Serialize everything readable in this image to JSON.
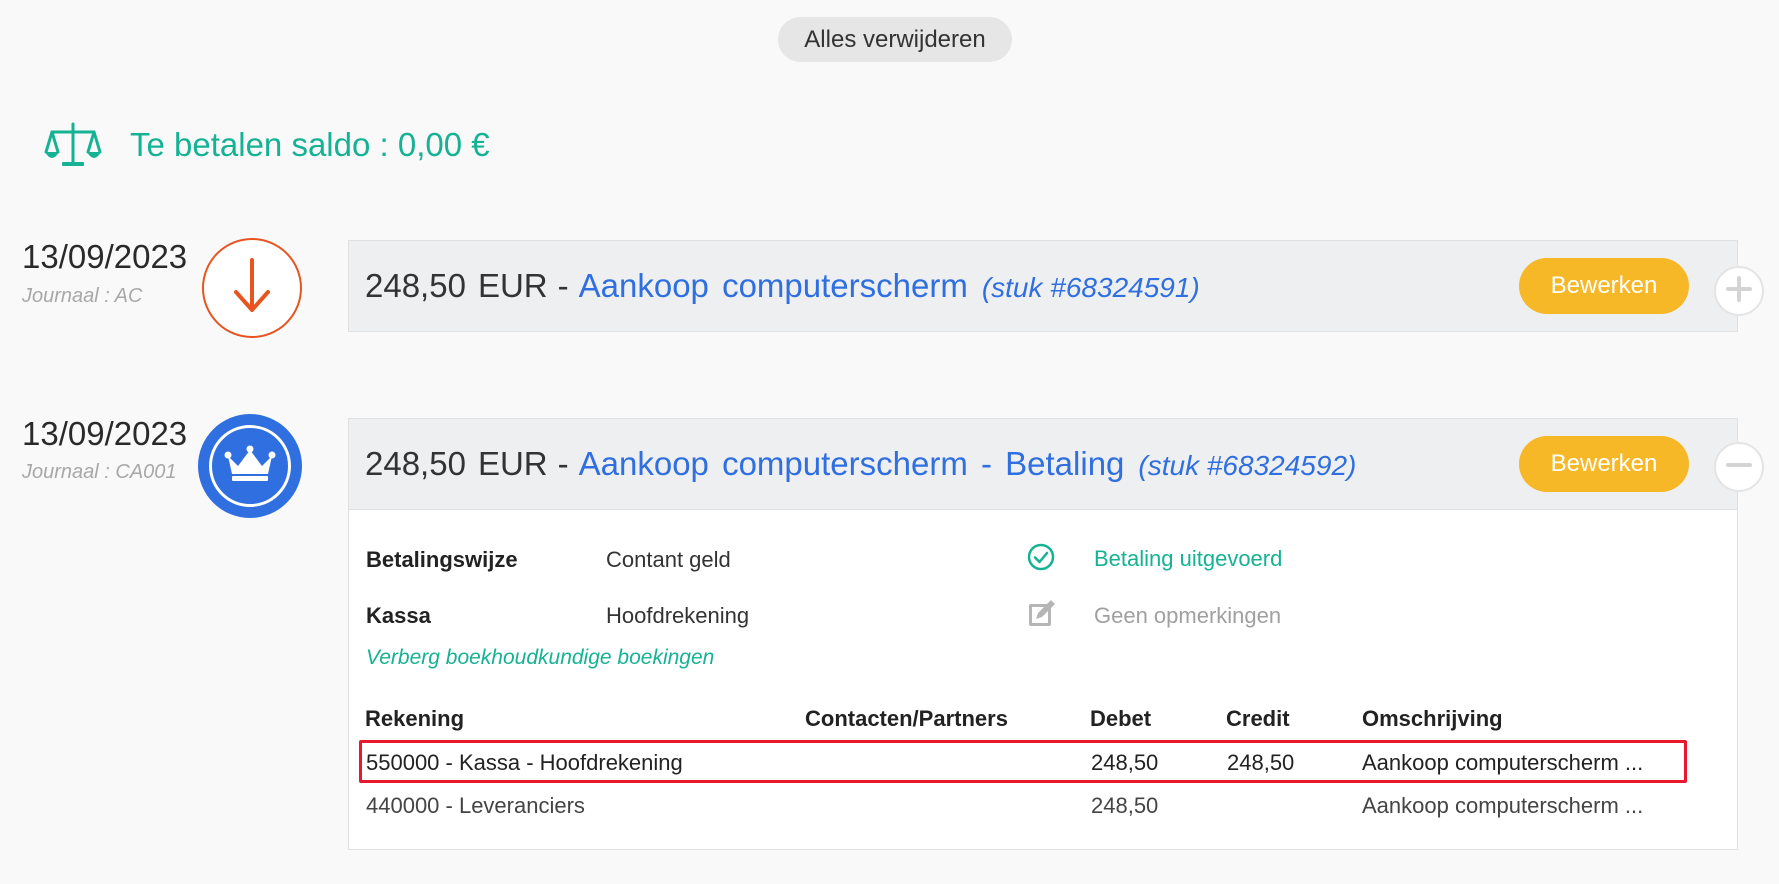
{
  "top": {
    "clear_all_label": "Alles verwijderen"
  },
  "balance": {
    "text": "Te betalen saldo : 0,00 €"
  },
  "entries": [
    {
      "date": "13/09/2023",
      "journal": "Journaal : AC",
      "icon": "arrow-down-icon",
      "amount": "248,50",
      "currency": "EUR",
      "separator": "-",
      "description": "Aankoop computerscherm",
      "piece": "(stuk #68324591)",
      "edit_label": "Bewerken",
      "toggle": "expand"
    },
    {
      "date": "13/09/2023",
      "journal": "Journaal : CA001",
      "icon": "crown-icon",
      "amount": "248,50",
      "currency": "EUR",
      "separator": "-",
      "description": "Aankoop computerscherm - Betaling",
      "piece": "(stuk #68324592)",
      "edit_label": "Bewerken",
      "toggle": "collapse",
      "details": {
        "payment_method_label": "Betalingswijze",
        "payment_method_value": "Contant geld",
        "register_label": "Kassa",
        "register_value": "Hoofdrekening",
        "payment_status": "Betaling uitgevoerd",
        "notes_status": "Geen opmerkingen",
        "toggle_link": "Verberg boekhoudkundige boekingen",
        "table": {
          "headers": [
            "Rekening",
            "Contacten/Partners",
            "Debet",
            "Credit",
            "Omschrijving"
          ],
          "rows": [
            {
              "account": "550000 - Kassa - Hoofdrekening",
              "contact": "",
              "debit": "248,50",
              "credit": "248,50",
              "description": "Aankoop computerscherm ...",
              "highlighted": true
            },
            {
              "account": "440000 - Leveranciers",
              "contact": "",
              "debit": "248,50",
              "credit": "",
              "description": "Aankoop computerscherm ...",
              "highlighted": false
            }
          ]
        }
      }
    }
  ],
  "colors": {
    "accent_green": "#16b294",
    "accent_blue": "#2f6fe0",
    "edit_yellow": "#f6b826",
    "out_orange": "#e8541f",
    "highlight_red": "#e8192c"
  }
}
